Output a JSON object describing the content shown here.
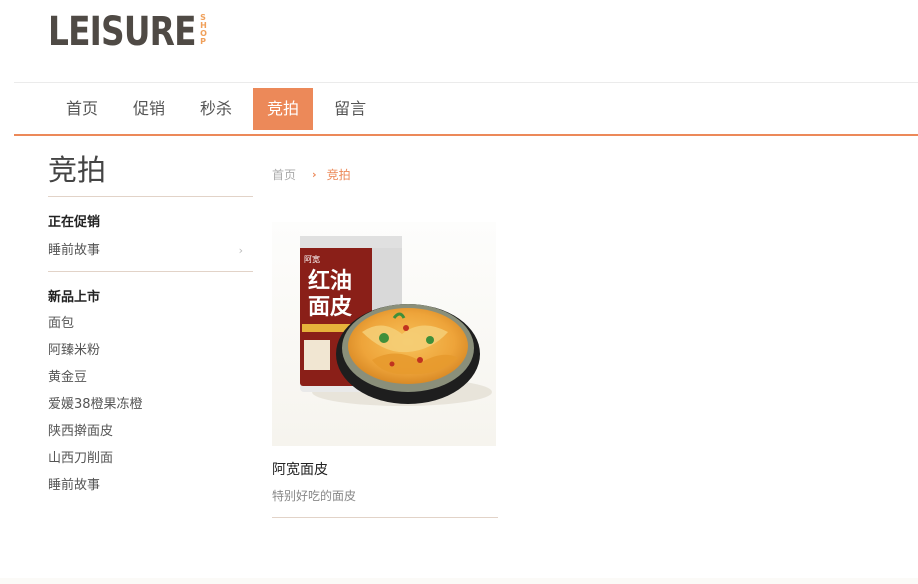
{
  "logo": {
    "main": "LEISURE",
    "side": [
      "S",
      "H",
      "O",
      "P"
    ]
  },
  "nav": {
    "items": [
      "首页",
      "促销",
      "秒杀",
      "竞拍",
      "留言"
    ],
    "active_index": 3
  },
  "sidebar": {
    "title": "竞拍",
    "group1": {
      "title": "正在促销",
      "items": [
        "睡前故事"
      ]
    },
    "group2": {
      "title": "新品上市",
      "items": [
        "面包",
        "阿臻米粉",
        "黄金豆",
        "爱媛38橙果冻橙",
        "陕西擀面皮",
        "山西刀削面",
        "睡前故事"
      ]
    }
  },
  "breadcrumb": {
    "home": "首页",
    "sep": "›",
    "current": "竞拍"
  },
  "product": {
    "name": "阿宽面皮",
    "desc": "特别好吃的面皮",
    "image_text": {
      "brand": "阿宽",
      "line1": "红油",
      "line2": "面皮"
    }
  },
  "colors": {
    "accent": "#ec8959"
  }
}
